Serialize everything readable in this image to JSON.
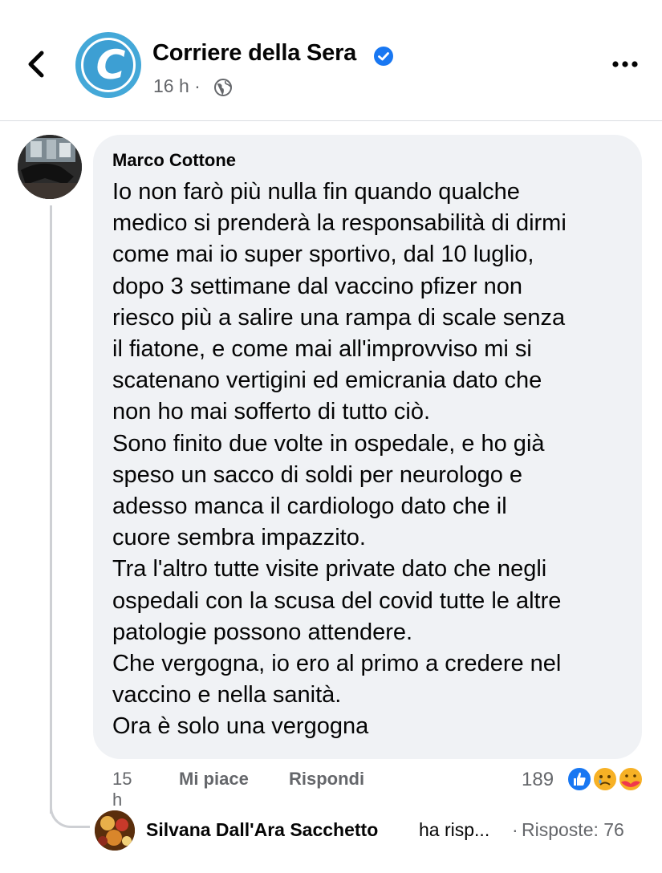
{
  "header": {
    "page_name": "Corriere della Sera",
    "avatar_letter": "C",
    "time": "16 h",
    "separator": "·",
    "icons": {
      "back": "chevron-left-icon",
      "verified": "verified-badge-icon",
      "privacy": "globe-icon",
      "more": "more-horizontal-icon"
    },
    "brand_color": "#3d9fd3",
    "verified_color": "#1877f2"
  },
  "comment": {
    "author": "Marco Cottone",
    "lines": [
      "Io non farò più nulla fin quando qualche",
      "medico si prenderà la responsabilità di dirmi",
      "come mai io super sportivo, dal 10 luglio,",
      "dopo 3 settimane dal vaccino pfizer non",
      "riesco più a salire una rampa di scale senza",
      "il fiatone, e come mai all'improvviso mi si",
      "scatenano vertigini ed emicrania dato che",
      "non ho mai sofferto di tutto ciò.",
      "Sono finito due volte in ospedale, e ho già",
      "speso un sacco di soldi per neurologo e",
      "adesso manca il cardiologo dato che il",
      "cuore sembra impazzito.",
      "Tra l'altro tutte visite private dato che negli",
      "ospedali con la scusa del covid tutte le altre",
      "patologie possono attendere.",
      "Che vergogna, io ero al primo a credere nel",
      "vaccino e nella sanità.",
      "Ora è solo una vergogna"
    ],
    "time": "15 h",
    "like_label": "Mi piace",
    "reply_label": "Rispondi",
    "reaction_count": "189",
    "reactions": [
      "like-icon",
      "sad-icon",
      "care-icon"
    ]
  },
  "reply_preview": {
    "name": "Silvana Dall'Ara Sacchetto",
    "action": "ha risp...",
    "separator": "·",
    "count_label": "Risposte: 76"
  }
}
